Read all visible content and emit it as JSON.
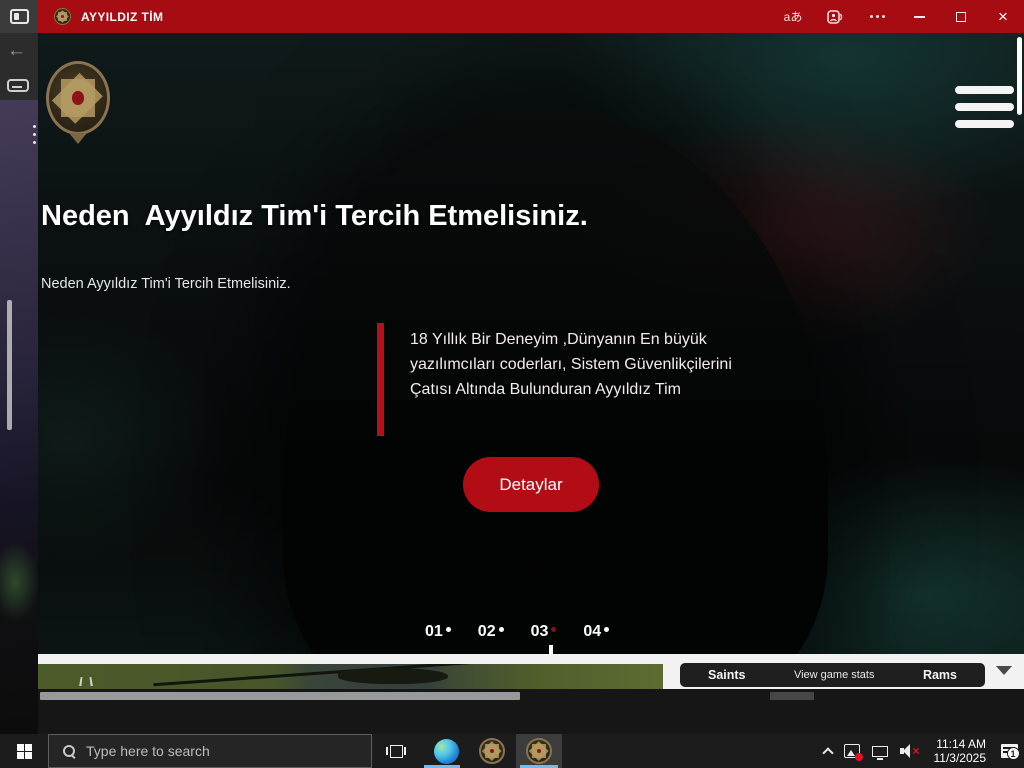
{
  "titlebar": {
    "title": "AYYILDIZ TİM",
    "color": "#a60c11",
    "text_size_glyph": "aあ"
  },
  "browser_rail": {
    "back_glyph": "←"
  },
  "hero": {
    "heading": "Neden  Ayyıldız Tim'i Tercih Etmelisiniz.",
    "subheading": "Neden Ayyıldız Tim'i Tercih Etmelisiniz.",
    "quote": "18 Yıllık Bir Deneyim ,Dünyanın En büyük yazılımcıları coderları, Sistem Güvenlikçilerini Çatısı Altında Bulunduran Ayyıldız Tim",
    "cta_label": "Detaylar",
    "accent_color": "#b20d15",
    "pagination": [
      {
        "label": "01",
        "active": false
      },
      {
        "label": "02",
        "active": false
      },
      {
        "label": "03",
        "active": true
      },
      {
        "label": "04",
        "active": false
      }
    ]
  },
  "sports_widget": {
    "team_left": "Saints",
    "center_label": "View game stats",
    "team_right": "Rams"
  },
  "taskbar": {
    "search_placeholder": "Type here to search",
    "clock_time": "11:14 AM",
    "clock_date": "11/3/2025",
    "notification_count": "1"
  }
}
